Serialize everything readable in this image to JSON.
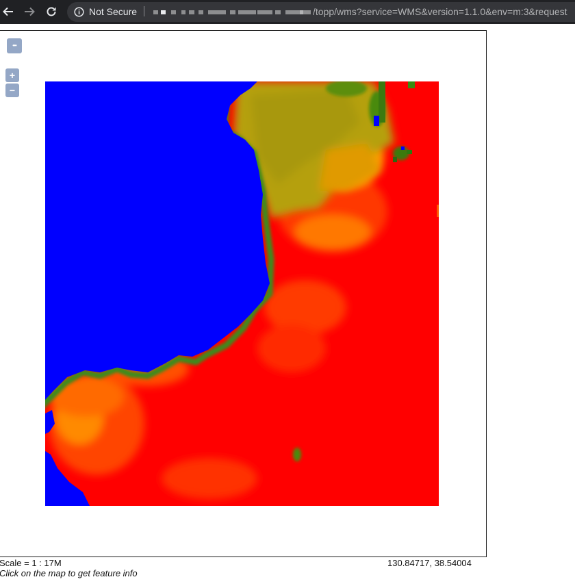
{
  "browser": {
    "security_label": "Not Secure",
    "url_path": "/topp/wms?service=WMS&version=1.1.0&env=m:3&request",
    "icons": [
      "back-arrow-icon",
      "forward-arrow-icon",
      "reload-icon",
      "info-icon"
    ]
  },
  "map": {
    "controls": {
      "menu_label": "•••",
      "zoom_in_label": "+",
      "zoom_out_label": "−"
    },
    "colors": {
      "water": "#0000ff",
      "low": "#2e8b1f",
      "mid": "#b09a10",
      "high": "#ff0000",
      "control": "#94a7c6"
    }
  },
  "footer": {
    "scale": "Scale = 1 : 17M",
    "coordinates": "130.84717, 38.54004",
    "hint": "Click on the map to get feature info"
  }
}
